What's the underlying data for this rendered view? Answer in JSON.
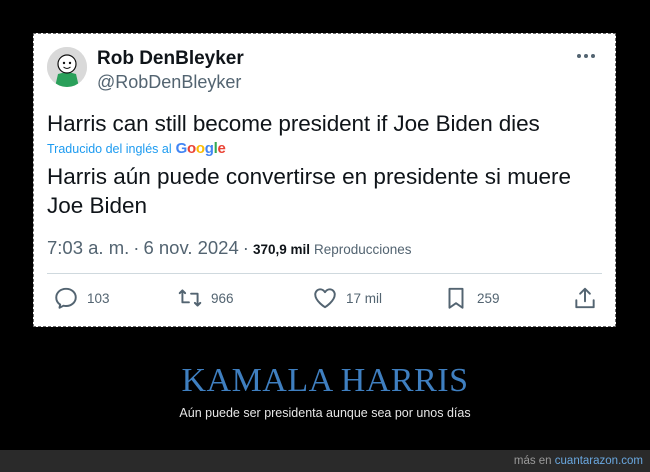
{
  "tweet": {
    "author_name": "Rob DenBleyker",
    "handle": "@RobDenBleyker",
    "text_original": "Harris can still become president if Joe Biden dies",
    "translated_label": "Traducido del inglés al",
    "translated_by": "Google",
    "text_translated": "Harris aún puede convertirse en presidente si muere Joe Biden",
    "time": "7:03 a. m.",
    "separator": "·",
    "date": "6 nov. 2024",
    "views_count": "370,9 mil",
    "views_label": "Reproducciones",
    "stats": {
      "replies": "103",
      "retweets": "966",
      "likes": "17 mil",
      "bookmarks": "259"
    }
  },
  "caption": {
    "title": "KAMALA HARRIS",
    "subtitle": "Aún puede ser presidenta aunque sea por unos días"
  },
  "footer": {
    "prefix": "más en",
    "site": "cuantarazon.com"
  },
  "icons": {
    "avatar": "cyanide-happiness-avatar",
    "more": "more-dots-icon",
    "reply": "reply-icon",
    "retweet": "retweet-icon",
    "like": "heart-icon",
    "bookmark": "bookmark-icon",
    "share": "share-icon"
  },
  "colors": {
    "accent": "#1d9bf0",
    "headline": "#3f7fc0",
    "secondary_text": "#536471",
    "footer_link": "#6aa8e0"
  }
}
